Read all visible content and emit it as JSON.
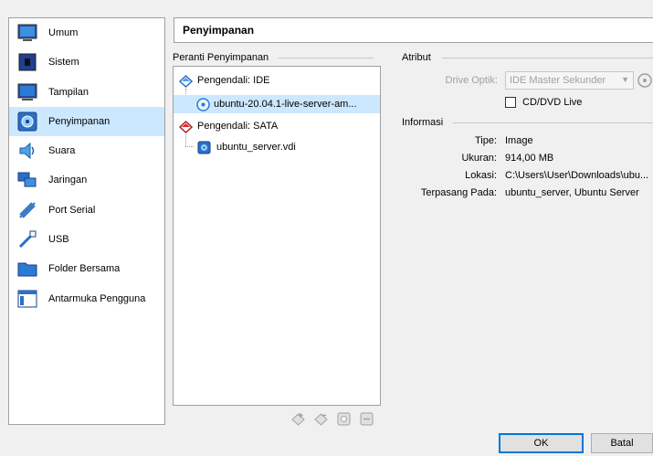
{
  "sidebar": {
    "items": [
      {
        "label": "Umum",
        "icon": "general-icon"
      },
      {
        "label": "Sistem",
        "icon": "system-icon"
      },
      {
        "label": "Tampilan",
        "icon": "display-icon"
      },
      {
        "label": "Penyimpanan",
        "icon": "storage-icon"
      },
      {
        "label": "Suara",
        "icon": "audio-icon"
      },
      {
        "label": "Jaringan",
        "icon": "network-icon"
      },
      {
        "label": "Port Serial",
        "icon": "serial-port-icon"
      },
      {
        "label": "USB",
        "icon": "usb-icon"
      },
      {
        "label": "Folder Bersama",
        "icon": "shared-folder-icon"
      },
      {
        "label": "Antarmuka Pengguna",
        "icon": "user-interface-icon"
      }
    ],
    "selected": "Penyimpanan"
  },
  "header": {
    "title": "Penyimpanan"
  },
  "storage": {
    "group_title": "Peranti Penyimpanan",
    "tree": [
      {
        "label": "Pengendali: IDE",
        "type": "controller"
      },
      {
        "label": "ubuntu-20.04.1-live-server-am...",
        "type": "optical",
        "selected": true
      },
      {
        "label": "Pengendali: SATA",
        "type": "controller"
      },
      {
        "label": "ubuntu_server.vdi",
        "type": "disk"
      }
    ]
  },
  "attributes": {
    "group_title": "Atribut",
    "drive_label": "Drive Optik:",
    "drive_value": "IDE Master Sekunder",
    "live_cd_label": "CD/DVD Live",
    "live_cd_checked": false
  },
  "info": {
    "group_title": "Informasi",
    "rows": [
      {
        "label": "Tipe:",
        "value": "Image"
      },
      {
        "label": "Ukuran:",
        "value": "914,00 MB"
      },
      {
        "label": "Lokasi:",
        "value": "C:\\Users\\User\\Downloads\\ubu..."
      },
      {
        "label": "Terpasang Pada:",
        "value": "ubuntu_server, Ubuntu Server"
      }
    ]
  },
  "buttons": {
    "ok": "OK",
    "cancel": "Batal"
  },
  "colors": {
    "selection": "#cce8ff",
    "accent": "#0078d7"
  }
}
